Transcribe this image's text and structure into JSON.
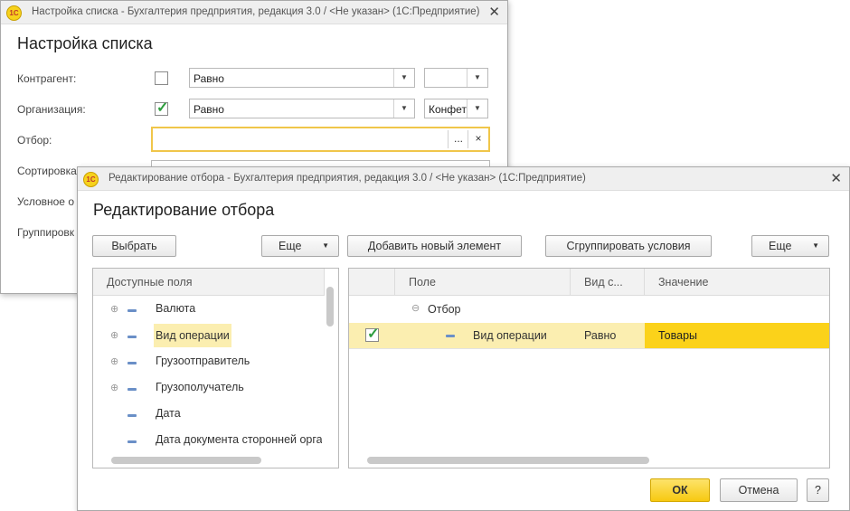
{
  "back_window": {
    "title": "Настройка списка - Бухгалтерия предприятия, редакция 3.0 / <Не указан>  (1С:Предприятие)",
    "logo": "1С",
    "heading": "Настройка списка",
    "rows": [
      {
        "label": "Контрагент:",
        "checked": false,
        "condition": "Равно",
        "value": ""
      },
      {
        "label": "Организация:",
        "checked": true,
        "condition": "Равно",
        "value": "Конфет"
      },
      {
        "label": "Отбор:",
        "value": ""
      },
      {
        "label": "Сортировка:"
      },
      {
        "label": "Условное о"
      },
      {
        "label": "Группировк"
      }
    ],
    "filter_btn_dots": "...",
    "filter_btn_clear": "×"
  },
  "front_window": {
    "title": "Редактирование отбора - Бухгалтерия предприятия, редакция 3.0 / <Не указан>  (1С:Предприятие)",
    "logo": "1С",
    "heading": "Редактирование отбора",
    "left_toolbar": {
      "select_label": "Выбрать",
      "more_label": "Еще"
    },
    "right_toolbar": {
      "add_label": "Добавить новый элемент",
      "group_label": "Сгруппировать условия",
      "more_label": "Еще"
    },
    "fields_panel": {
      "header": "Доступные поля",
      "items": [
        {
          "label": "Валюта",
          "expandable": true
        },
        {
          "label": "Вид операции",
          "expandable": true
        },
        {
          "label": "Грузоотправитель",
          "expandable": true
        },
        {
          "label": "Грузополучатель",
          "expandable": true
        },
        {
          "label": "Дата",
          "expandable": false
        },
        {
          "label": "Дата документа сторонней орга",
          "expandable": false
        }
      ]
    },
    "conditions_panel": {
      "columns": {
        "field": "Поле",
        "type": "Вид с...",
        "value": "Значение"
      },
      "group_label": "Отбор",
      "rows": [
        {
          "checked": true,
          "field": "Вид операции",
          "type": "Равно",
          "value": "Товары"
        }
      ]
    },
    "ok_label": "ОК",
    "cancel_label": "Отмена",
    "help_label": "?"
  },
  "colors": {
    "accent_yellow": "#fbd21a",
    "highlight": "#fbeeb0",
    "check_green": "#2e9e3e",
    "tree_dash": "#6a8fc7"
  }
}
